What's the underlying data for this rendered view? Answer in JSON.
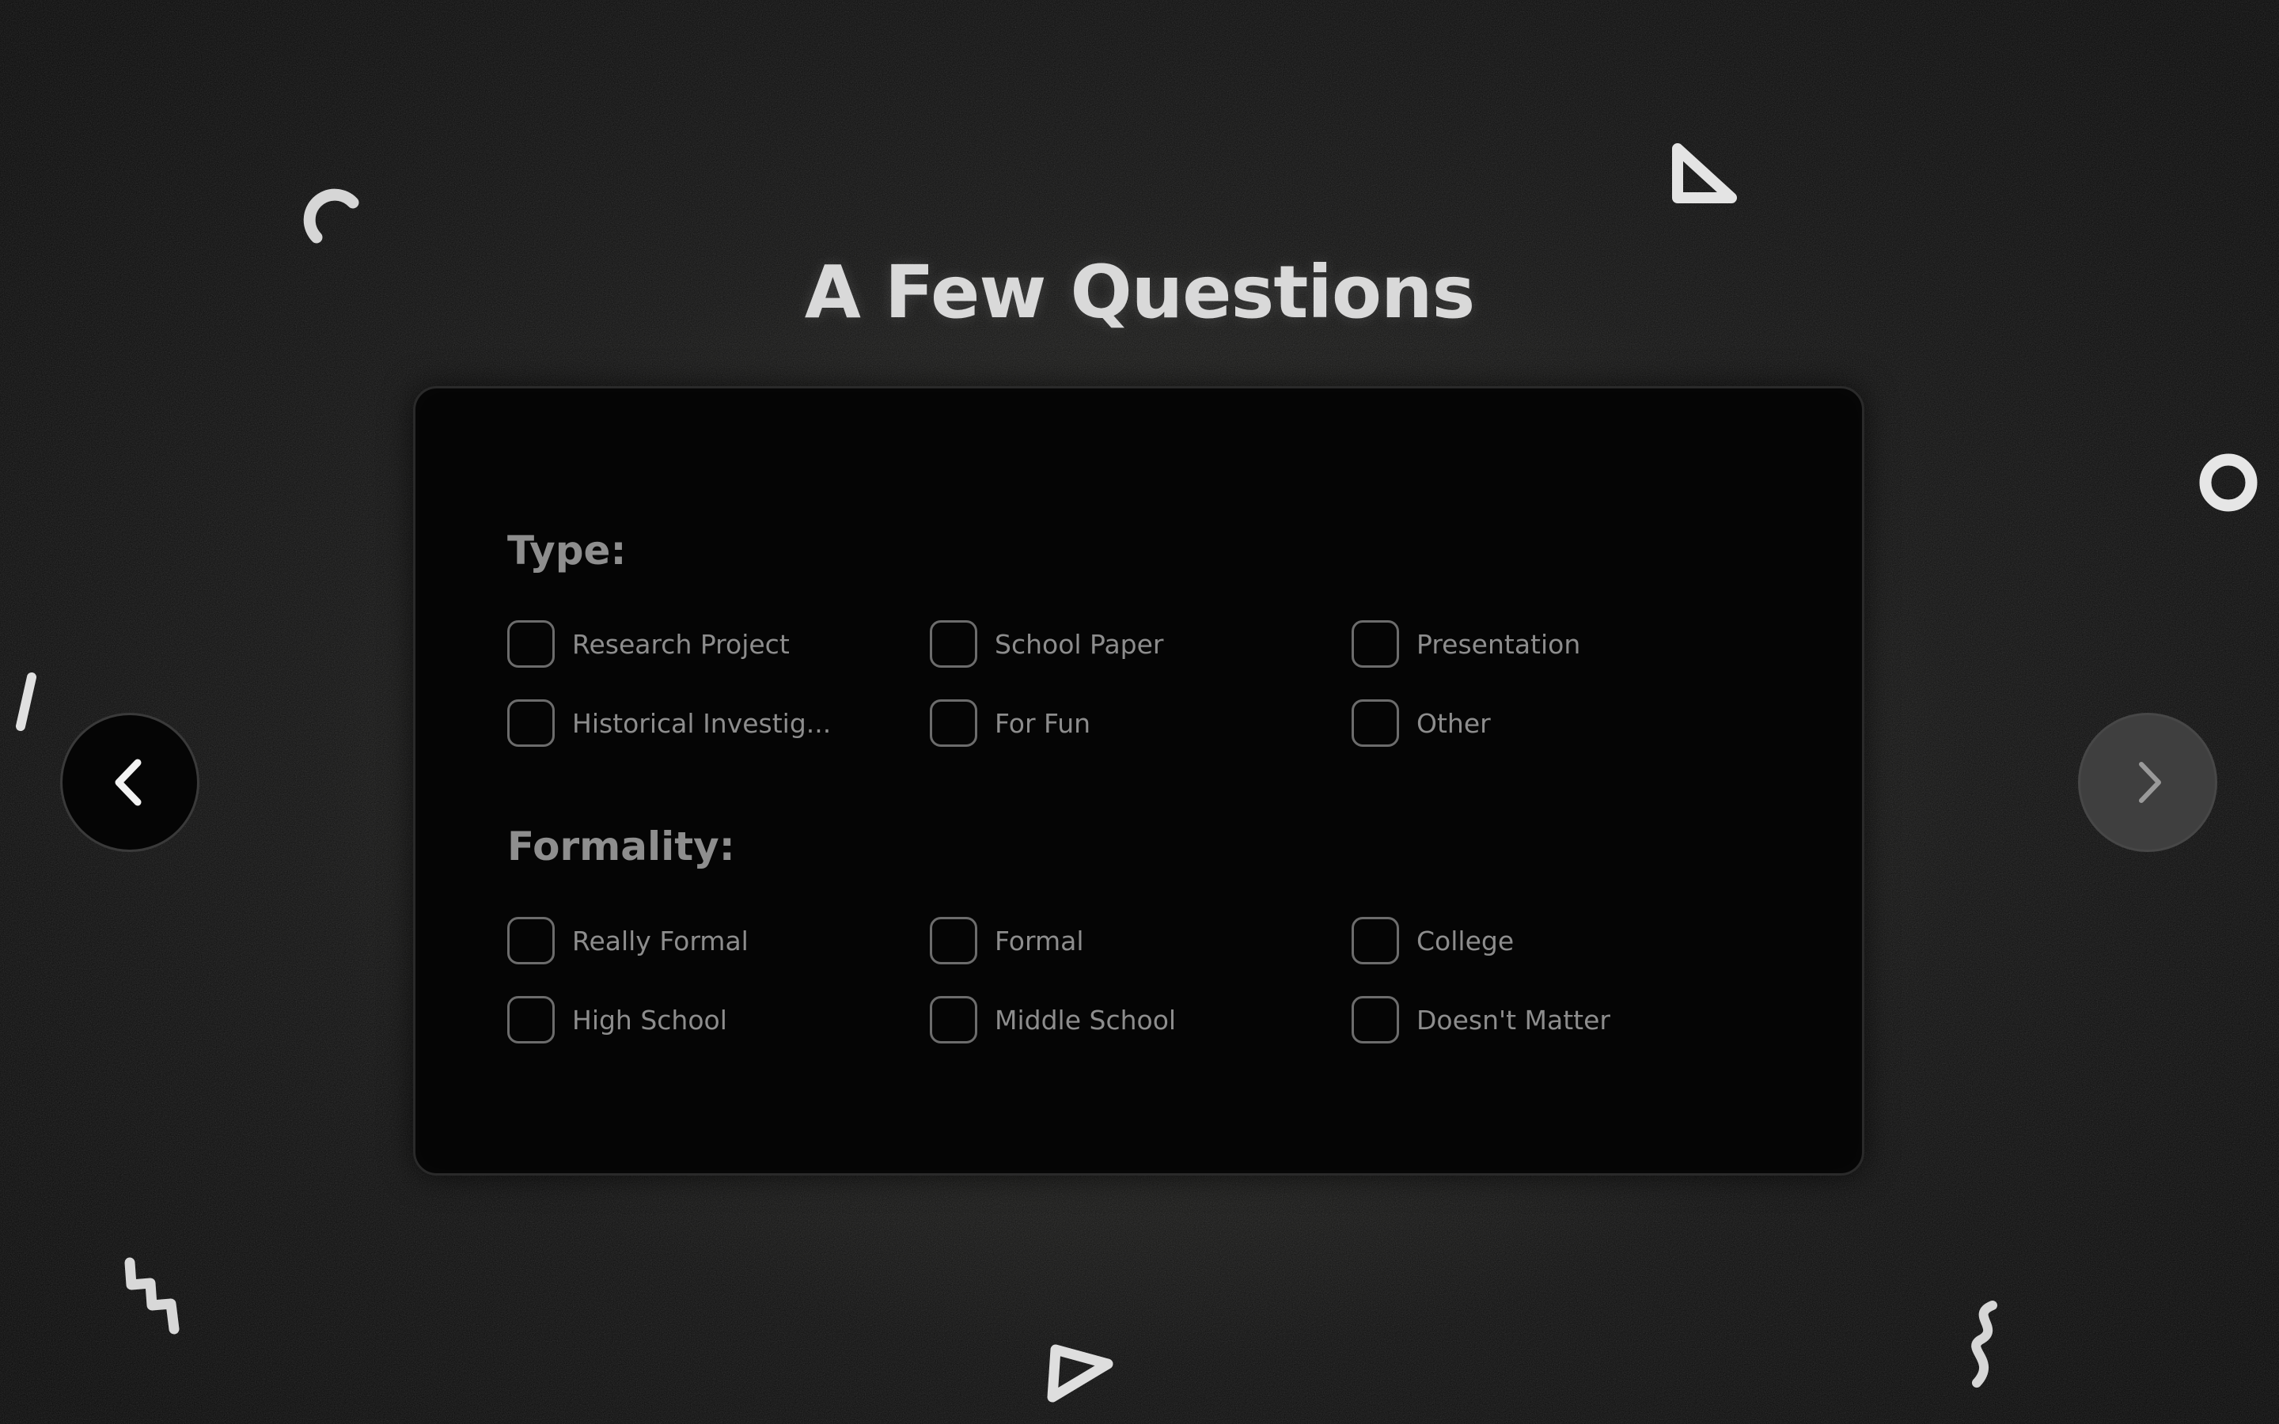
{
  "page": {
    "title": "A Few Questions"
  },
  "colors": {
    "background": "#0b0b0b",
    "card": "#050505",
    "card_border": "#2a2a2a",
    "title": "#d9d9d9",
    "section_title": "#8e8e8e",
    "option_text": "#8d8d8d",
    "checkbox_border": "#6c6c6c",
    "next_button": "#3f3f3f",
    "prev_button": "#050505"
  },
  "questions": {
    "type": {
      "label": "Type:",
      "options": [
        {
          "label": "Research Project",
          "checked": false
        },
        {
          "label": "School Paper",
          "checked": false
        },
        {
          "label": "Presentation",
          "checked": false
        },
        {
          "label": "Historical Investig...",
          "checked": false
        },
        {
          "label": "For Fun",
          "checked": false
        },
        {
          "label": "Other",
          "checked": false
        }
      ]
    },
    "formality": {
      "label": "Formality:",
      "options": [
        {
          "label": "Really Formal",
          "checked": false
        },
        {
          "label": "Formal",
          "checked": false
        },
        {
          "label": "College",
          "checked": false
        },
        {
          "label": "High School",
          "checked": false
        },
        {
          "label": "Middle School",
          "checked": false
        },
        {
          "label": "Doesn't Matter",
          "checked": false
        }
      ]
    }
  },
  "navigation": {
    "prev_icon": "chevron-left-icon",
    "next_icon": "chevron-right-icon"
  },
  "decorations": [
    "arc-shape",
    "triangle-shape",
    "ring-shape",
    "dash-shape",
    "zigzag-shape",
    "triangle-outline-shape",
    "squiggle-shape"
  ]
}
